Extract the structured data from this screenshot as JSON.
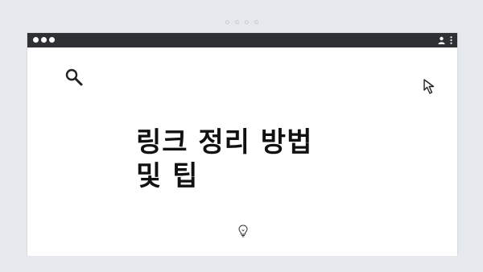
{
  "pagination": {
    "dot_count": 4
  },
  "browser": {
    "title_bar_color": "#2e3033",
    "controls_color": "#ffffff"
  },
  "content": {
    "headline_line_1": "링크 정리 방법",
    "headline_line_2": "및 팁"
  },
  "icons": {
    "search": "search-icon",
    "cursor": "cursor-arrow-icon",
    "bulb": "lightbulb-icon",
    "user": "user-icon",
    "menu": "kebab-menu-icon"
  }
}
